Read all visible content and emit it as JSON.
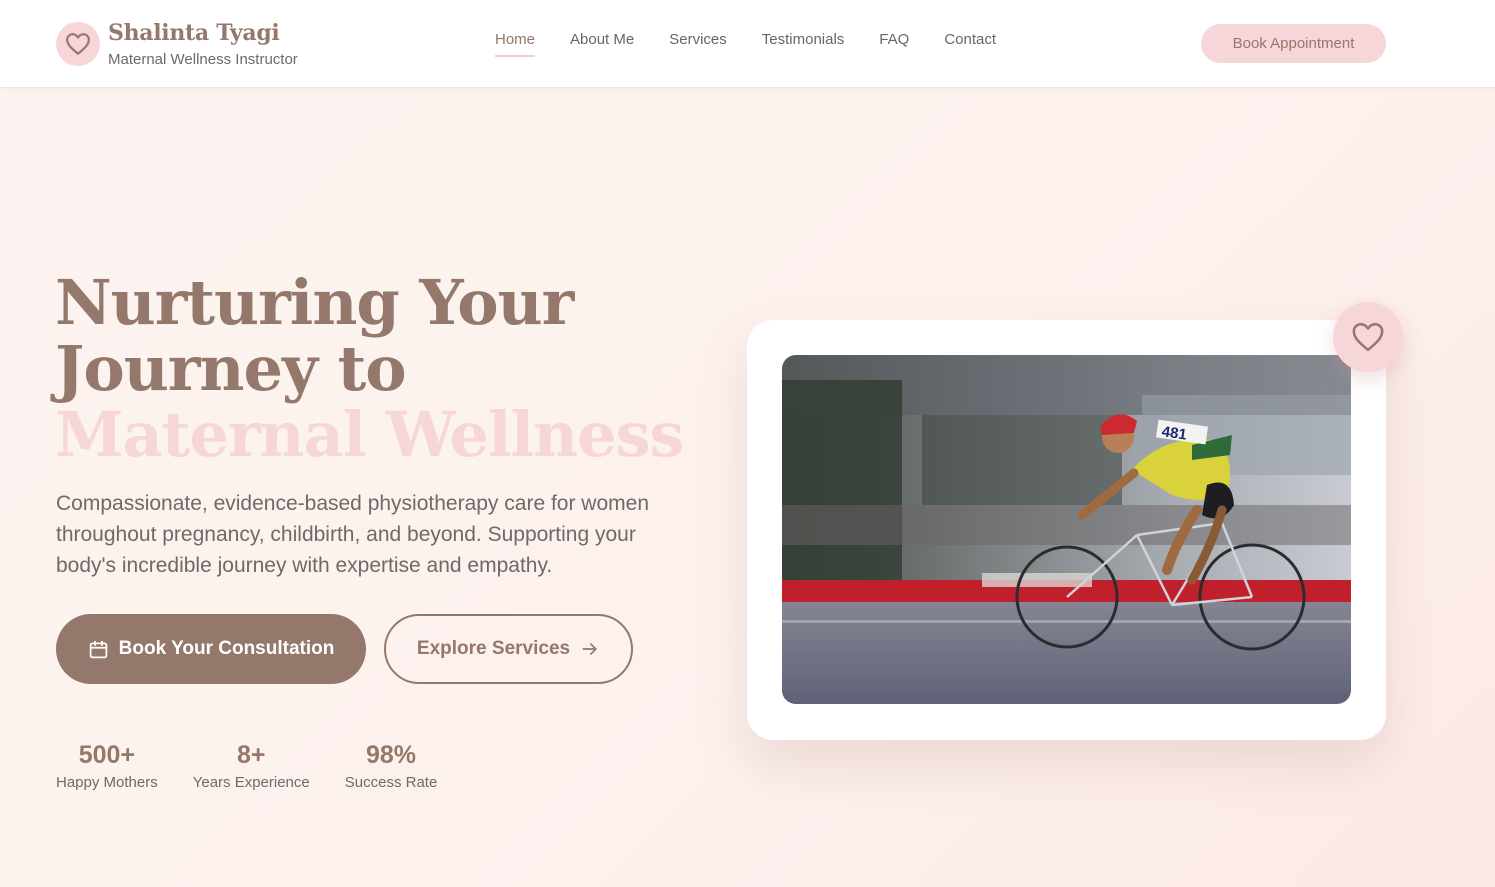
{
  "brand": {
    "name": "Shalinta Tyagi",
    "subtitle": "Maternal Wellness Instructor",
    "icon": "heart-icon"
  },
  "nav": {
    "items": [
      {
        "label": "Home",
        "active": true
      },
      {
        "label": "About Me",
        "active": false
      },
      {
        "label": "Services",
        "active": false
      },
      {
        "label": "Testimonials",
        "active": false
      },
      {
        "label": "FAQ",
        "active": false
      },
      {
        "label": "Contact",
        "active": false
      }
    ],
    "cta_label": "Book Appointment"
  },
  "hero": {
    "title_line1": "Nurturing Your",
    "title_line2": "Journey to",
    "title_accent": "Maternal Wellness",
    "description": "Compassionate, evidence-based physiotherapy care for women throughout pregnancy, childbirth, and beyond. Supporting your body's incredible journey with expertise and empathy.",
    "primary_button": {
      "label": "Book Your Consultation",
      "icon": "calendar-icon"
    },
    "secondary_button": {
      "label": "Explore Services",
      "icon": "arrow-right-icon"
    }
  },
  "stats": [
    {
      "value": "500+",
      "label": "Happy Mothers"
    },
    {
      "value": "8+",
      "label": "Years Experience"
    },
    {
      "value": "98%",
      "label": "Success Rate"
    }
  ],
  "photo_card": {
    "badge_icon": "heart-icon",
    "bib_number": "481"
  },
  "colors": {
    "brand": "#94786b",
    "accent_pink": "#f7d6d9",
    "text": "#6f6a66",
    "background": "#fbf3ef"
  }
}
